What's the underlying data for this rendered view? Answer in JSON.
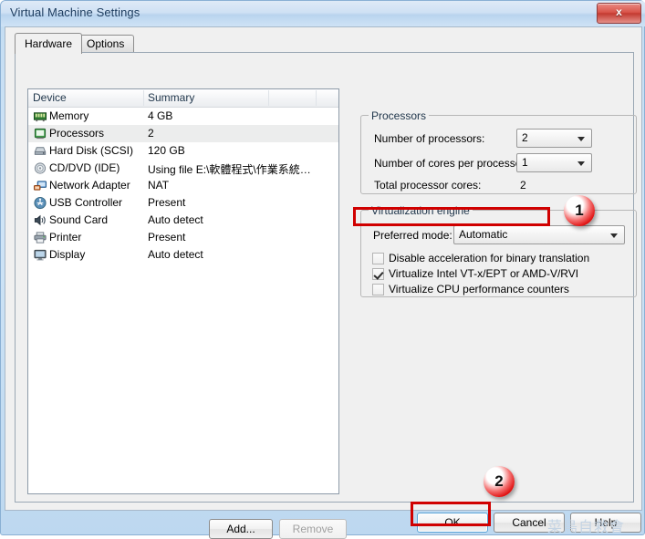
{
  "window": {
    "title": "Virtual Machine Settings",
    "close_label": "x"
  },
  "tabs": [
    {
      "label": "Hardware",
      "active": true
    },
    {
      "label": "Options",
      "active": false
    }
  ],
  "device_list": {
    "columns": [
      "Device",
      "Summary"
    ],
    "rows": [
      {
        "icon": "memory-icon",
        "device": "Memory",
        "summary": "4 GB",
        "selected": false
      },
      {
        "icon": "processor-icon",
        "device": "Processors",
        "summary": "2",
        "selected": true
      },
      {
        "icon": "harddisk-icon",
        "device": "Hard Disk (SCSI)",
        "summary": "120 GB",
        "selected": false
      },
      {
        "icon": "cddvd-icon",
        "device": "CD/DVD (IDE)",
        "summary": "Using file E:\\軟體程式\\作業系統…",
        "selected": false
      },
      {
        "icon": "network-adapter-icon",
        "device": "Network Adapter",
        "summary": "NAT",
        "selected": false
      },
      {
        "icon": "usb-icon",
        "device": "USB Controller",
        "summary": "Present",
        "selected": false
      },
      {
        "icon": "sound-card-icon",
        "device": "Sound Card",
        "summary": "Auto detect",
        "selected": false
      },
      {
        "icon": "printer-icon",
        "device": "Printer",
        "summary": "Present",
        "selected": false
      },
      {
        "icon": "display-icon",
        "device": "Display",
        "summary": "Auto detect",
        "selected": false
      }
    ]
  },
  "list_buttons": {
    "add_label": "Add...",
    "remove_label": "Remove",
    "remove_disabled": true
  },
  "processors_group": {
    "title": "Processors",
    "number_of_processors_label": "Number of processors:",
    "number_of_processors_value": "2",
    "cores_per_processor_label": "Number of cores per processor:",
    "cores_per_processor_value": "1",
    "total_cores_label": "Total processor cores:",
    "total_cores_value": "2"
  },
  "virtualization_group": {
    "title": "Virtualization engine",
    "preferred_mode_label": "Preferred mode:",
    "preferred_mode_value": "Automatic",
    "checkboxes": [
      {
        "label": "Disable acceleration for binary translation",
        "checked": false
      },
      {
        "label": "Virtualize Intel VT-x/EPT or AMD-V/RVI",
        "checked": true
      },
      {
        "label": "Virtualize CPU performance counters",
        "checked": false
      }
    ]
  },
  "annotations": [
    {
      "number": "1",
      "target": "virtualize-vtx-checkbox"
    },
    {
      "number": "2",
      "target": "ok-button"
    }
  ],
  "dialog_buttons": {
    "ok_label": "OK",
    "cancel_label": "Cancel",
    "help_label": "Help"
  },
  "watermark": "菜鳥自救會",
  "colors": {
    "annotation_red": "#d00000",
    "title_text": "#1d3c5e",
    "focus_blue": "#5ba4d6",
    "selection_gray": "#eceded"
  }
}
